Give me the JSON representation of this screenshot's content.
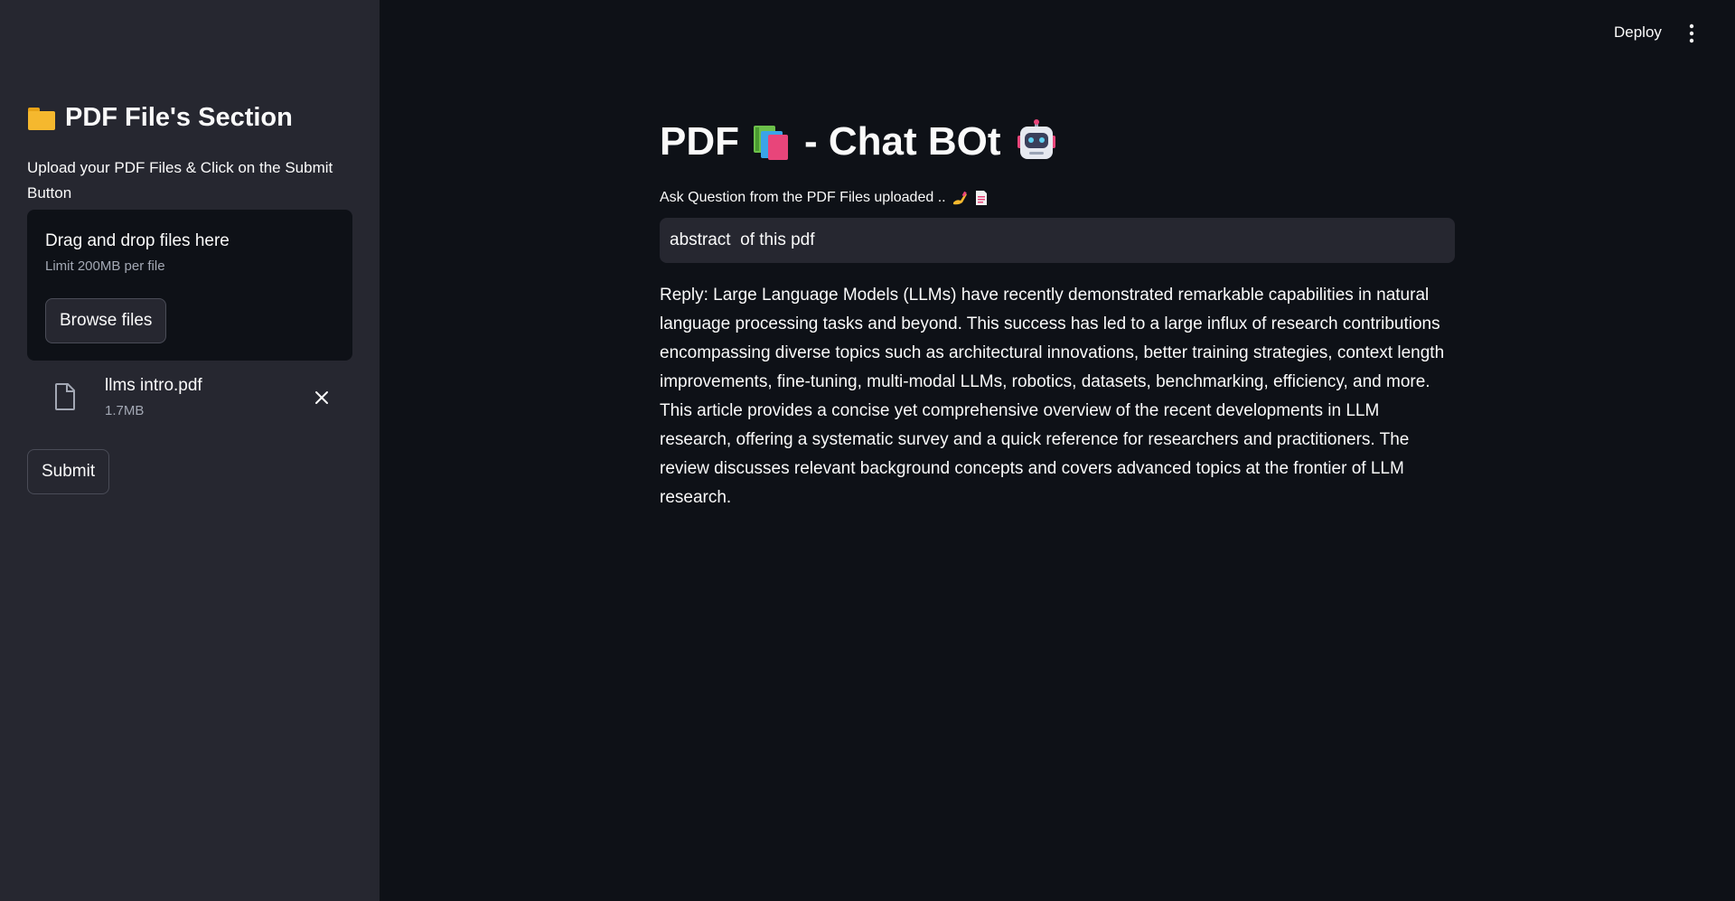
{
  "sidebar": {
    "title": "PDF File's Section",
    "title_icon": "folder-icon",
    "description": "Upload your PDF Files & Click on the Submit Button",
    "uploader": {
      "drag_text": "Drag and drop files here",
      "limit_text": "Limit 200MB per file",
      "browse_label": "Browse files"
    },
    "uploaded_file": {
      "name": "llms intro.pdf",
      "size": "1.7MB",
      "icon": "file-icon"
    },
    "submit_label": "Submit"
  },
  "header": {
    "deploy_label": "Deploy",
    "menu_icon": "vertical-dots-icon"
  },
  "main": {
    "title_prefix": "PDF",
    "title_suffix": "- Chat BOt",
    "title_icons": [
      "books-icon",
      "robot-icon"
    ],
    "question_label": "Ask Question from the PDF Files uploaded ..",
    "question_icons": [
      "writing-hand-icon",
      "document-icon"
    ],
    "question_value": "abstract  of this pdf",
    "reply": "Reply: Large Language Models (LLMs) have recently demonstrated remarkable capabilities in natural language processing tasks and beyond. This success has led to a large influx of research contributions encompassing diverse topics such as architectural innovations, better training strategies, context length improvements, fine-tuning, multi-modal LLMs, robotics, datasets, benchmarking, efficiency, and more. This article provides a concise yet comprehensive overview of the recent developments in LLM research, offering a systematic survey and a quick reference for researchers and practitioners. The review discusses relevant background concepts and covers advanced topics at the frontier of LLM research."
  },
  "colors": {
    "background": "#0e1117",
    "sidebar": "#262730",
    "text": "#fafafa",
    "muted": "#a3a8b4"
  }
}
